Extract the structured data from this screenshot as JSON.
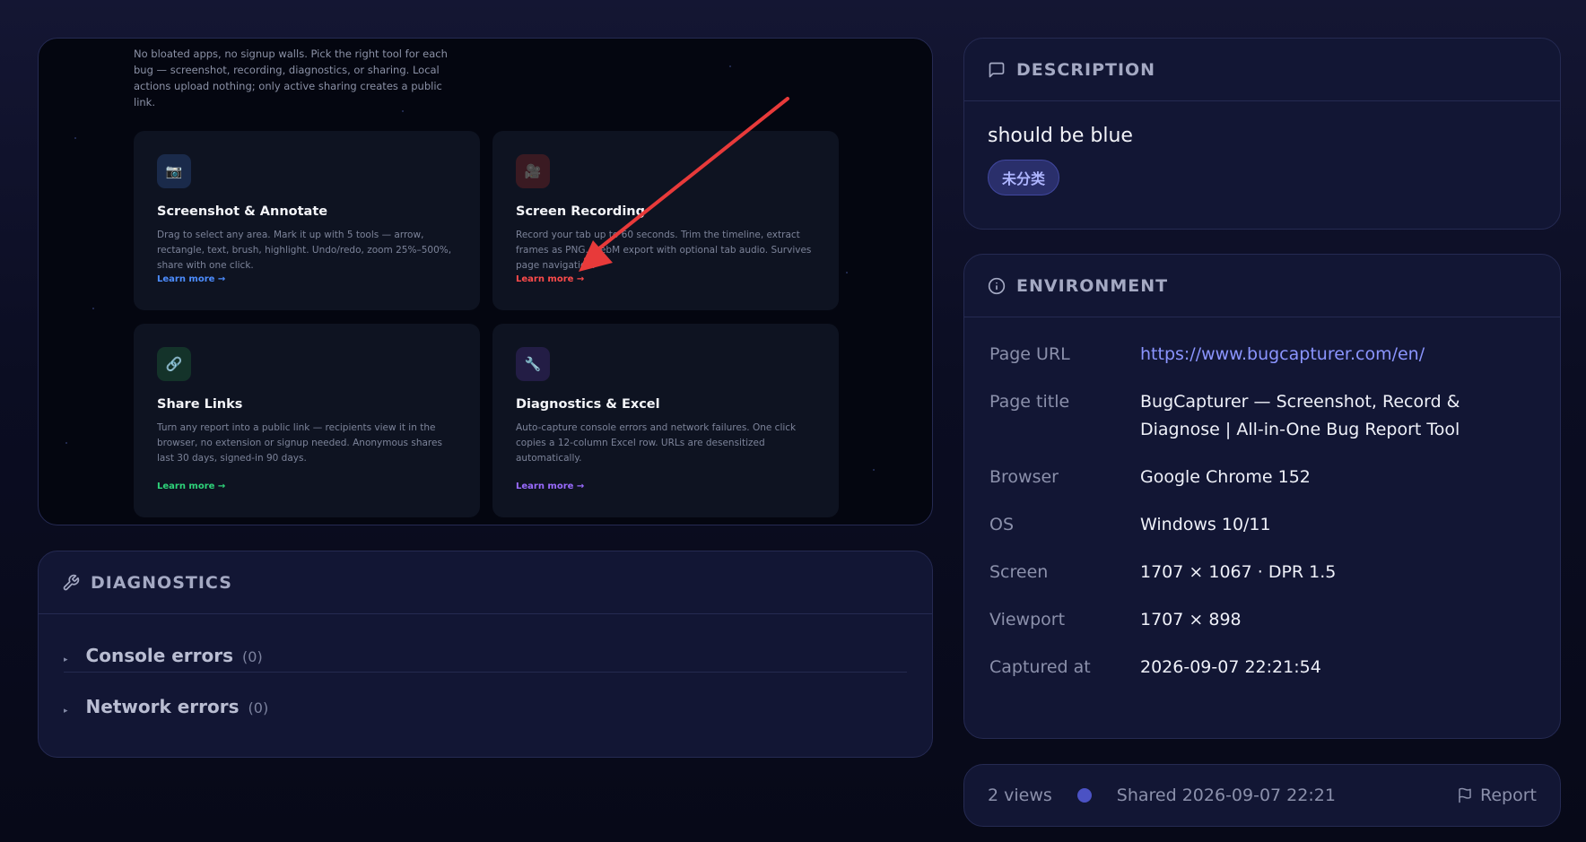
{
  "preview": {
    "intro": "No bloated apps, no signup walls. Pick the right tool for each bug — screenshot, recording, diagnostics, or sharing. Local actions upload nothing; only active sharing creates a public link.",
    "features": [
      {
        "icon": "📷",
        "title": "Screenshot & Annotate",
        "desc": "Drag to select any area. Mark it up with 5 tools — arrow, rectangle, text, brush, highlight. Undo/redo, zoom 25%–500%, share with one click.",
        "link": "Learn more →",
        "color": "#4d8dff",
        "icon_bg": "#1a2a4a"
      },
      {
        "icon": "🎥",
        "title": "Screen Recording",
        "desc": "Record your tab up to 60 seconds. Trim the timeline, extract frames as PNG. WebM export with optional tab audio. Survives page navigation.",
        "link": "Learn more →",
        "color": "#ff4b4b",
        "icon_bg": "#3a1a22"
      },
      {
        "icon": "🔗",
        "title": "Share Links",
        "desc": "Turn any report into a public link — recipients view it in the browser, no extension or signup needed. Anonymous shares last 30 days, signed-in 90 days.",
        "link": "Learn more →",
        "color": "#2ed47a",
        "icon_bg": "#14332a"
      },
      {
        "icon": "🔧",
        "title": "Diagnostics & Excel",
        "desc": "Auto-capture console errors and network failures. One click copies a 12-column Excel row. URLs are desensitized automatically.",
        "link": "Learn more →",
        "color": "#9a6bff",
        "icon_bg": "#231d45"
      }
    ]
  },
  "diagnostics": {
    "title": "DIAGNOSTICS",
    "rows": [
      {
        "label": "Console errors",
        "count": "(0)"
      },
      {
        "label": "Network errors",
        "count": "(0)"
      }
    ]
  },
  "description": {
    "title": "DESCRIPTION",
    "text": "should be blue",
    "badge": "未分类"
  },
  "environment": {
    "title": "ENVIRONMENT",
    "rows": [
      {
        "key": "Page URL",
        "value": "https://www.bugcapturer.com/en/"
      },
      {
        "key": "Page title",
        "value": "BugCapturer — Screenshot, Record & Diagnose | All-in-One Bug Report Tool"
      },
      {
        "key": "Browser",
        "value": "Google Chrome 152"
      },
      {
        "key": "OS",
        "value": "Windows 10/11"
      },
      {
        "key": "Screen",
        "value": "1707 × 1067 · DPR 1.5"
      },
      {
        "key": "Viewport",
        "value": "1707 × 898"
      },
      {
        "key": "Captured at",
        "value": "2026-09-07 22:21:54"
      }
    ]
  },
  "footer": {
    "views": "2 views",
    "shared": "Shared 2026-09-07 22:21",
    "report": "Report"
  },
  "colors": {
    "accent": "#4b52c4",
    "link": "#8b95ff",
    "annotation_arrow": "#e83a3a"
  }
}
